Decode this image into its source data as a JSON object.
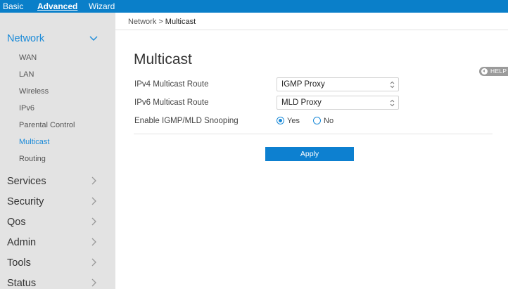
{
  "top_nav": {
    "tabs": [
      {
        "label": "Basic",
        "active": false
      },
      {
        "label": "Advanced",
        "active": true
      },
      {
        "label": "Wizard",
        "active": false
      }
    ]
  },
  "sidebar": {
    "network": {
      "label": "Network",
      "expanded": true,
      "items": [
        "WAN",
        "LAN",
        "Wireless",
        "IPv6",
        "Parental Control",
        "Multicast",
        "Routing"
      ],
      "active_item": "Multicast"
    },
    "sections": [
      "Services",
      "Security",
      "Qos",
      "Admin",
      "Tools",
      "Status"
    ]
  },
  "breadcrumb": {
    "parent": "Network",
    "separator": ">",
    "current": "Multicast"
  },
  "main": {
    "title": "Multicast",
    "help_label": "HELP",
    "ipv4_route": {
      "label": "IPv4 Multicast Route",
      "value": "IGMP Proxy"
    },
    "ipv6_route": {
      "label": "IPv6 Multicast Route",
      "value": "MLD Proxy"
    },
    "snooping": {
      "label": "Enable IGMP/MLD Snooping",
      "options": [
        {
          "label": "Yes",
          "checked": true
        },
        {
          "label": "No",
          "checked": false
        }
      ]
    },
    "apply_label": "Apply"
  },
  "colors": {
    "topbar": "#0a7fc9",
    "accent": "#1a8ad8",
    "sidebar_bg": "#e3e3e3",
    "button": "#0d80d0"
  }
}
